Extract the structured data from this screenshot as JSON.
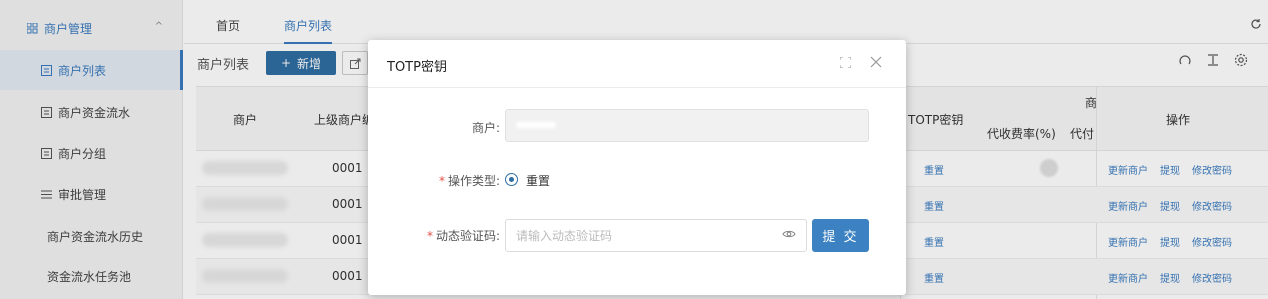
{
  "sidebar": {
    "group_label": "商户管理",
    "items": [
      {
        "label": "商户列表"
      },
      {
        "label": "商户资金流水"
      },
      {
        "label": "商户分组"
      },
      {
        "label": "审批管理"
      },
      {
        "label": "商户资金流水历史"
      },
      {
        "label": "资金流水任务池"
      }
    ]
  },
  "tabs": [
    {
      "label": "首页"
    },
    {
      "label": "商户列表"
    }
  ],
  "toolbar": {
    "page_title": "商户列表",
    "new_label": "新增"
  },
  "table": {
    "headers": {
      "merchant": "商户",
      "parent_code": "上级商户编",
      "totp": "TOTP密钥",
      "group_partial": "商",
      "collection_rate": "代收费率(%)",
      "payout_partial": "代付",
      "actions": "操作"
    },
    "rows": [
      {
        "code": "0001",
        "totp_action": "重置",
        "ops": [
          "更新商户",
          "提现",
          "修改密码"
        ]
      },
      {
        "code": "0001",
        "totp_action": "重置",
        "ops": [
          "更新商户",
          "提现",
          "修改密码"
        ]
      },
      {
        "code": "0001",
        "totp_action": "重置",
        "ops": [
          "更新商户",
          "提现",
          "修改密码"
        ]
      },
      {
        "code": "0001",
        "totp_action": "重置",
        "ops": [
          "更新商户",
          "提现",
          "修改密码"
        ]
      }
    ]
  },
  "modal": {
    "title": "TOTP密钥",
    "merchant_label": "商户:",
    "op_type_label": "操作类型:",
    "op_type_value": "重置",
    "code_label": "动态验证码:",
    "code_placeholder": "请输入动态验证码",
    "submit_label": "提 交"
  },
  "colors": {
    "accent": "#3a7bbf",
    "primary_button": "#2f6ea3",
    "required": "#e0524a"
  }
}
